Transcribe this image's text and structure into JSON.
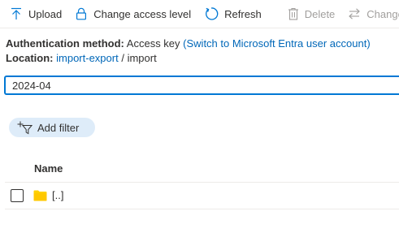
{
  "toolbar": {
    "items": [
      {
        "label": "Upload",
        "icon": "upload-icon",
        "disabled": false
      },
      {
        "label": "Change access level",
        "icon": "lock-icon",
        "disabled": false
      },
      {
        "label": "Refresh",
        "icon": "refresh-icon",
        "disabled": false
      },
      {
        "label": "Delete",
        "icon": "trash-icon",
        "disabled": true
      },
      {
        "label": "Change",
        "icon": "swap-arrows-icon",
        "disabled": true
      }
    ]
  },
  "info": {
    "auth_key": "Authentication method:",
    "auth_value": "Access key",
    "auth_link": "(Switch to Microsoft Entra user account)",
    "location_key": "Location:",
    "location_link": "import-export",
    "location_separator": "/",
    "location_current": "import"
  },
  "search": {
    "value": "2024-04"
  },
  "filter": {
    "add_label": "Add filter",
    "icon": "filter-plus-icon"
  },
  "table": {
    "columns": [
      "Name"
    ],
    "rows": [
      {
        "name": "[..]",
        "icon": "folder-icon"
      }
    ]
  },
  "colors": {
    "accent": "#0078d4",
    "link": "#0067b8",
    "folder": "#ffd100",
    "pill": "#deecf9",
    "disabled": "#a19f9d"
  }
}
